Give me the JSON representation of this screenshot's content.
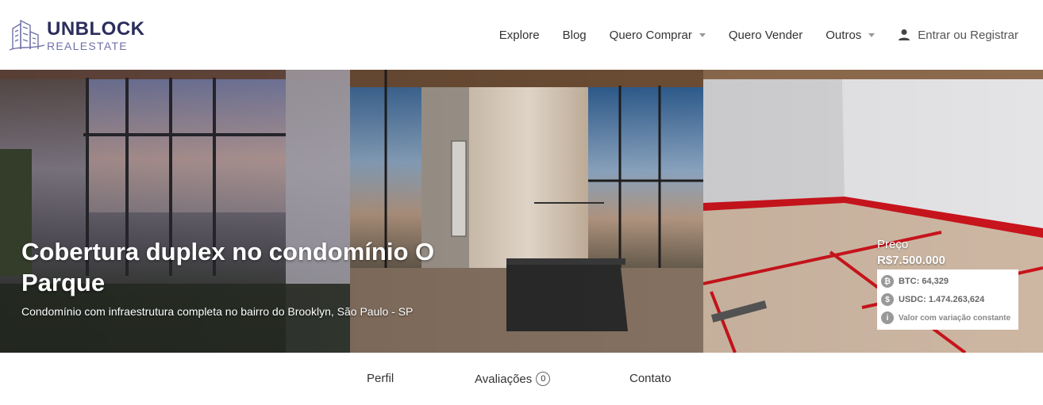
{
  "brand": {
    "name_top": "UNBLOCK",
    "name_bottom": "REALESTATE"
  },
  "nav": {
    "explore": "Explore",
    "blog": "Blog",
    "buy": "Quero Comprar",
    "sell": "Quero Vender",
    "others": "Outros",
    "login": "Entrar ou Registrar"
  },
  "hero": {
    "title": "Cobertura duplex no condomínio O Parque",
    "subtitle": "Condomínio com infraestrutura completa no bairro do Brooklyn, São Paulo - SP"
  },
  "price": {
    "label": "Preço",
    "value": "R$7.500.000",
    "btc": "BTC: 64,329",
    "usdc": "USDC: 1.474.263,624",
    "note": "Valor com variação constante"
  },
  "tabs": {
    "profile": "Perfil",
    "reviews": "Avaliações",
    "reviews_count": "0",
    "contact": "Contato"
  },
  "colors": {
    "brand_dark": "#2b2d5c",
    "brand_light": "#6f71a8",
    "accent_red": "#cc1a1a"
  }
}
